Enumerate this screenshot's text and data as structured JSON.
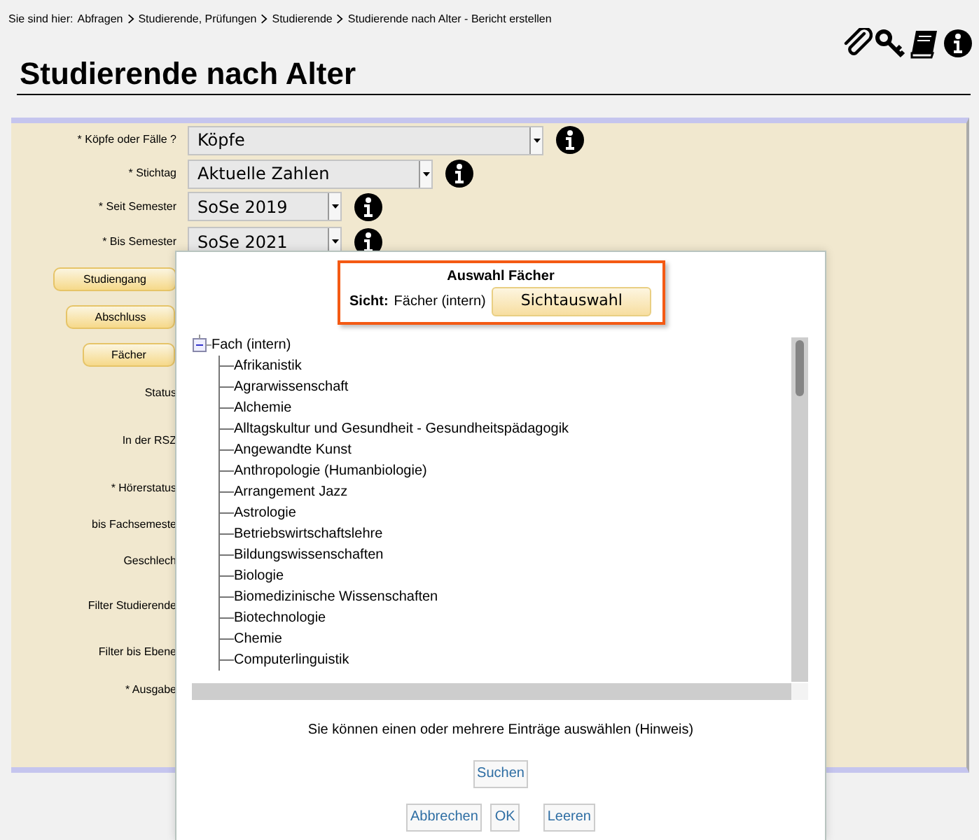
{
  "breadcrumb": {
    "label": "Sie sind hier:",
    "links": [
      "Abfragen",
      "Studierende, Prüfungen",
      "Studierende"
    ],
    "current": "Studierende nach Alter - Bericht erstellen"
  },
  "title": "Studierende nach Alter",
  "form": {
    "fields": [
      {
        "kind": "select",
        "label": "* Köpfe oder Fälle ?",
        "value": "Köpfe"
      },
      {
        "kind": "select",
        "label": "* Stichtag",
        "value": "Aktuelle Zahlen"
      },
      {
        "kind": "select",
        "label": "* Seit Semester",
        "value": "SoSe 2019"
      },
      {
        "kind": "select",
        "label": "* Bis Semester",
        "value": "SoSe 2021"
      },
      {
        "kind": "button",
        "label": "Studiengang"
      },
      {
        "kind": "button",
        "label": "Abschluss"
      },
      {
        "kind": "button",
        "label": "Fächer"
      },
      {
        "kind": "text",
        "label": "Status"
      },
      {
        "kind": "text",
        "label": "In der RSZ"
      },
      {
        "kind": "text",
        "label": "* Hörerstatus"
      },
      {
        "kind": "text",
        "label": "bis Fachsemeste"
      },
      {
        "kind": "text",
        "label": "Geschlech"
      },
      {
        "kind": "text",
        "label": "Filter Studierende"
      },
      {
        "kind": "text",
        "label": "Filter bis Ebene"
      },
      {
        "kind": "text",
        "label": "* Ausgabe"
      }
    ]
  },
  "dialog": {
    "title": "Auswahl Fächer",
    "view_label": "Sicht:",
    "view_value": "Fächer (intern)",
    "view_button": "Sichtauswahl",
    "tree": {
      "label": "Fach (intern)",
      "expanded": true,
      "children": [
        {
          "label": "Afrikanistik"
        },
        {
          "label": "Agrarwissenschaft"
        },
        {
          "label": "Alchemie"
        },
        {
          "label": "Alltagskultur und Gesundheit - Gesundheitspädagogik"
        },
        {
          "label": "Angewandte Kunst"
        },
        {
          "label": "Anthropologie (Humanbiologie)"
        },
        {
          "label": "Arrangement Jazz"
        },
        {
          "label": "Astrologie"
        },
        {
          "label": "Betriebswirtschaftslehre"
        },
        {
          "label": "Bildungswissenschaften"
        },
        {
          "label": "Biologie"
        },
        {
          "label": "Biomedizinische Wissenschaften"
        },
        {
          "label": "Biotechnologie"
        },
        {
          "label": "Chemie"
        },
        {
          "label": "Computerlinguistik"
        }
      ]
    },
    "hint_text": "Sie können einen oder mehrere Einträge auswählen (",
    "hint_link": "Hinweis",
    "hint_end": ")",
    "search_button": "Suchen",
    "buttons": [
      "Abbrechen",
      "OK",
      "Leeren"
    ]
  }
}
